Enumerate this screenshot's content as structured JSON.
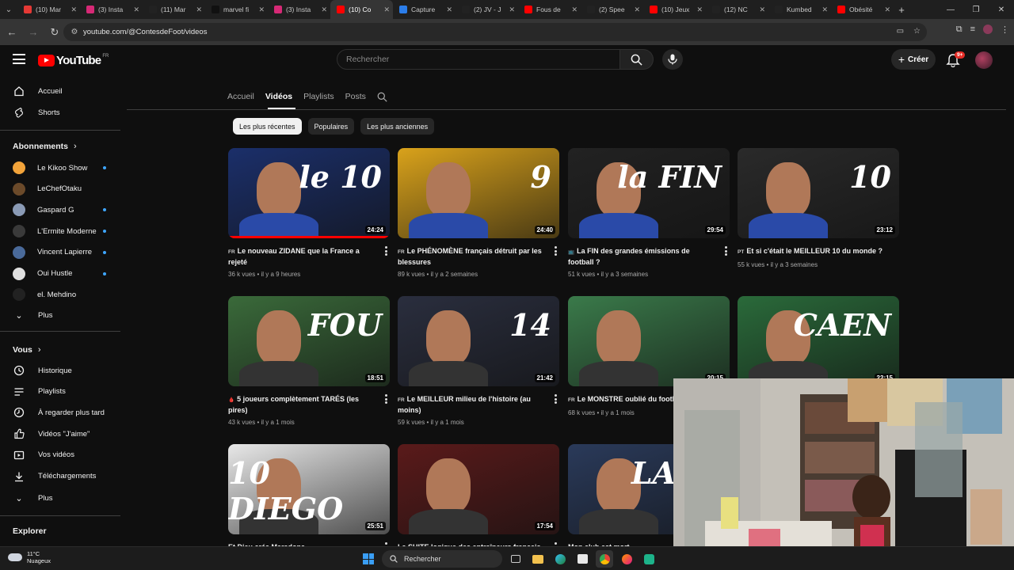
{
  "browser": {
    "tabs": [
      {
        "title": "(10) Mar",
        "fav": "x-icon",
        "color": "#e53935"
      },
      {
        "title": "(3) Insta",
        "fav": "instagram-icon",
        "color": "#d62976"
      },
      {
        "title": "(11) Mar",
        "fav": "x-icon",
        "color": "#222222"
      },
      {
        "title": "marvel fi",
        "fav": "tiktok-icon",
        "color": "#111111"
      },
      {
        "title": "(3) Insta",
        "fav": "instagram-icon",
        "color": "#d62976"
      },
      {
        "title": "(10) Co",
        "fav": "youtube-icon",
        "color": "#ff0000",
        "active": true
      },
      {
        "title": "Capture",
        "fav": "capture-icon",
        "color": "#2b7de9"
      },
      {
        "title": "(2) JV - J",
        "fav": "x-icon",
        "color": "#222222"
      },
      {
        "title": "Fous de",
        "fav": "youtube-icon",
        "color": "#ff0000"
      },
      {
        "title": "(2) Spee",
        "fav": "x-icon",
        "color": "#222222"
      },
      {
        "title": "(10) Jeux",
        "fav": "youtube-icon",
        "color": "#ff0000"
      },
      {
        "title": "(12) NC",
        "fav": "x-icon",
        "color": "#222222"
      },
      {
        "title": "Kumbed",
        "fav": "x-icon",
        "color": "#222222"
      },
      {
        "title": "Obésité",
        "fav": "youtube-icon",
        "color": "#ff0000"
      }
    ],
    "url": "youtube.com/@ContesdeFoot/videos"
  },
  "header": {
    "logo_text": "YouTube",
    "country_code": "FR",
    "search_placeholder": "Rechercher",
    "create_label": "Créer",
    "notif_count": "9+"
  },
  "sidebar": {
    "main": [
      {
        "label": "Accueil",
        "icon": "home-icon"
      },
      {
        "label": "Shorts",
        "icon": "shorts-icon"
      }
    ],
    "subs_title": "Abonnements",
    "subs": [
      {
        "label": "Le Kikoo Show",
        "color": "#f2a33a",
        "dot": true
      },
      {
        "label": "LeChefOtaku",
        "color": "#6b4a2a",
        "dot": false
      },
      {
        "label": "Gaspard G",
        "color": "#8a9ab5",
        "dot": true
      },
      {
        "label": "L'Ermite Moderne",
        "color": "#3a3a3a",
        "dot": true
      },
      {
        "label": "Vincent Lapierre",
        "color": "#4a6a9a",
        "dot": true
      },
      {
        "label": "Oui Hustle",
        "color": "#e0e0e0",
        "dot": true
      },
      {
        "label": "el. Mehdino",
        "color": "#222222",
        "dot": false
      }
    ],
    "subs_more": "Plus",
    "you_title": "Vous",
    "you": [
      {
        "label": "Historique",
        "icon": "history-icon"
      },
      {
        "label": "Playlists",
        "icon": "playlists-icon"
      },
      {
        "label": "À regarder plus tard",
        "icon": "watch-later-icon"
      },
      {
        "label": "Vidéos \"J'aime\"",
        "icon": "like-icon"
      },
      {
        "label": "Vos vidéos",
        "icon": "your-videos-icon"
      },
      {
        "label": "Téléchargements",
        "icon": "download-icon"
      }
    ],
    "you_more": "Plus",
    "explore_title": "Explorer"
  },
  "channel": {
    "tabs": [
      "Accueil",
      "Vidéos",
      "Playlists",
      "Posts"
    ],
    "active_tab": "Vidéos",
    "chips": [
      "Les plus récentes",
      "Populaires",
      "Les plus anciennes"
    ]
  },
  "videos": [
    {
      "flag": "FR",
      "title": "Le nouveau ZIDANE que la France a rejeté",
      "views": "36 k vues",
      "age": "il y a 9 heures",
      "duration": "24:24",
      "progress": 1.0,
      "bg": "#1b2f6a",
      "big": "le 10"
    },
    {
      "flag": "FR",
      "title": "Le PHÉNOMÈNE français détruit par les blessures",
      "views": "89 k vues",
      "age": "il y a 2 semaines",
      "duration": "24:40",
      "progress": 0,
      "bg": "#d9a21b",
      "big": "9"
    },
    {
      "flag": "📺",
      "title": "La FIN des grandes émissions de football ?",
      "views": "51 k vues",
      "age": "il y a 3 semaines",
      "duration": "29:54",
      "progress": 0,
      "bg": "#222222",
      "big": "la FIN"
    },
    {
      "flag": "PT",
      "title": "Et si c'était le MEILLEUR 10 du monde ?",
      "views": "55 k vues",
      "age": "il y a 3 semaines",
      "duration": "23:12",
      "progress": 0,
      "bg": "#2a2a2a",
      "big": "10"
    },
    {
      "flag": "🩸",
      "title": "5 joueurs complètement TARÉS (les pires)",
      "views": "43 k vues",
      "age": "il y a 1 mois",
      "duration": "18:51",
      "progress": 0,
      "bg": "#3a6a3a",
      "big": "FOU"
    },
    {
      "flag": "FR",
      "title": "Le MEILLEUR milieu de l'histoire (au moins)",
      "views": "59 k vues",
      "age": "il y a 1 mois",
      "duration": "21:42",
      "progress": 0,
      "bg": "#2a2e3e",
      "big": "14"
    },
    {
      "flag": "FR",
      "title": "Le MONSTRE oublié du footba",
      "views": "68 k vues",
      "age": "il y a 1 mois",
      "duration": "20:15",
      "progress": 0,
      "bg": "#3a7a4a",
      "big": ""
    },
    {
      "flag": "",
      "title": "",
      "views": "",
      "age": "",
      "duration": "22:15",
      "progress": 0,
      "bg": "#2a6a3a",
      "big": "CAEN"
    },
    {
      "flag": "",
      "title": "Et Dieu créa Maradona",
      "views": "",
      "age": "",
      "duration": "25:51",
      "progress": 0,
      "bg": "#e8e8e8",
      "big": "10 DIEGO"
    },
    {
      "flag": "",
      "title": "La SUITE logique des entraîneurs français",
      "views": "",
      "age": "",
      "duration": "17:54",
      "progress": 0,
      "bg": "#5a1a1a",
      "big": ""
    },
    {
      "flag": "",
      "title": "Mon club est mort",
      "views": "",
      "age": "",
      "duration": "",
      "progress": 0,
      "bg": "#2a3a5a",
      "big": "LA FI"
    }
  ],
  "taskbar": {
    "temp": "11°C",
    "weather": "Nuageux",
    "search": "Rechercher"
  }
}
